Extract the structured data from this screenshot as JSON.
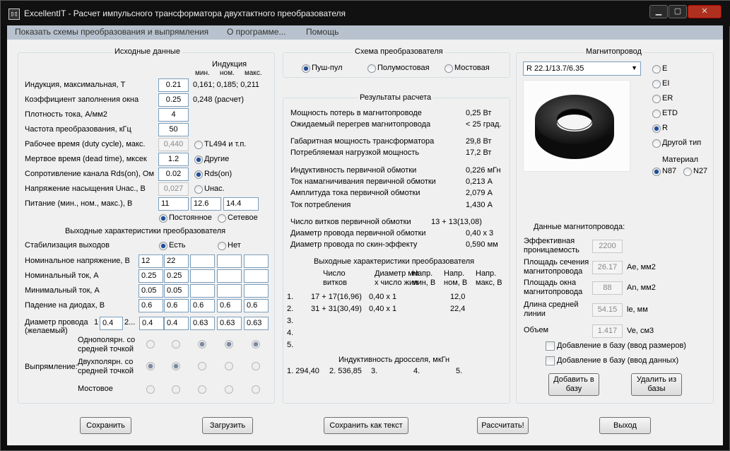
{
  "window": {
    "title": "ExcellentIT - Расчет импульсного трансформатора двухтактного преобразователя",
    "icon": "app-icon",
    "controls": [
      "minimize",
      "maximize",
      "close"
    ]
  },
  "menu": [
    "Показать схемы преобразования и выпрямления",
    "О программе...",
    "Помощь"
  ],
  "input": {
    "title": "Исходные данные",
    "induction_header": "Индукция",
    "induction_sub": [
      "мин.",
      "ном.",
      "макс."
    ],
    "rows": [
      {
        "label": "Индукция, максимальная, Т",
        "value": "0.21",
        "note": "0,161; 0,185; 0,211"
      },
      {
        "label": "Коэффициент заполнения окна",
        "value": "0.25",
        "note": "0,248 (расчет)"
      },
      {
        "label": "Плотность тока, А/мм2",
        "value": "4",
        "note": ""
      },
      {
        "label": "Частота преобразования, кГц",
        "value": "50",
        "note": ""
      },
      {
        "label": "Рабочее время (duty cycle), макс.",
        "value": "0,440",
        "note": "TL494 и т.п."
      },
      {
        "label": "Мертвое время (dead time), мксек",
        "value": "1.2",
        "note": "Другие"
      },
      {
        "label": "Сопротивление канала Rds(on), Ом",
        "value": "0.02",
        "note": "Rds(on)"
      },
      {
        "label": "Напряжение насыщения Uнас., В",
        "value": "0,027",
        "note": "Uнас."
      },
      {
        "label": "Питание (мин., ном., макс.), В",
        "values": [
          "11",
          "12.6",
          "14.4"
        ]
      }
    ],
    "supply": [
      "Постоянное",
      "Сетевое"
    ]
  },
  "output": {
    "title": "Выходные характеристики преобразователя",
    "stab_label": "Стабилизация выходов",
    "stab_options": [
      "Есть",
      "Нет"
    ],
    "rows": [
      {
        "label": "Номинальное напряжение, В",
        "cells": [
          "12",
          "22",
          "",
          "",
          ""
        ]
      },
      {
        "label": "Номинальный ток, А",
        "cells": [
          "0.25",
          "0.25",
          "",
          "",
          ""
        ]
      },
      {
        "label": "Минимальный ток, А",
        "cells": [
          "0.05",
          "0.05",
          "",
          "",
          ""
        ]
      },
      {
        "label": "Падение на диодах, В",
        "cells": [
          "0.6",
          "0.6",
          "0.6",
          "0.6",
          "0.6"
        ]
      },
      {
        "label": "Диаметр провода (желаемый)",
        "prefix": [
          "1",
          "2..."
        ],
        "primary": "0.4",
        "cells": [
          "0.4",
          "0.4",
          "0.63",
          "0.63",
          "0.63"
        ]
      }
    ],
    "rect_label": "Выпрямление:",
    "rect_modes": [
      "Однополярн. со средней точкой",
      "Двухполярн. со средней точкой",
      "Мостовое"
    ],
    "rect_matrix": [
      [
        false,
        false,
        true,
        true,
        true
      ],
      [
        true,
        true,
        false,
        false,
        false
      ],
      [
        false,
        false,
        false,
        false,
        false
      ]
    ]
  },
  "scheme": {
    "title": "Схема преобразователя",
    "options": [
      "Пуш-пул",
      "Полумостовая",
      "Мостовая"
    ],
    "selected": 0
  },
  "results": {
    "title": "Результаты расчета",
    "groups": [
      [
        [
          "Мощность потерь в магнитопроводе",
          "0,25 Вт"
        ],
        [
          "Ожидаемый перегрев магнитопровода",
          "< 25 град."
        ]
      ],
      [
        [
          "Габаритная мощность трансформатора",
          "29,8 Вт"
        ],
        [
          "Потребляемая нагрузкой мощность",
          "17,2 Вт"
        ]
      ],
      [
        [
          "Индуктивность первичной обмотки",
          "0,226 мГн"
        ],
        [
          "Ток намагничивания первичной обмотки",
          "0,213 А"
        ],
        [
          "Амплитуда тока первичной обмотки",
          "2,079 А"
        ],
        [
          "Ток потребления",
          "1,430 А"
        ]
      ],
      [
        [
          "Число витков первичной обмотки",
          "13 + 13(13,08)"
        ],
        [
          "Диаметр провода первичной обмотки",
          "0,40 x 3"
        ],
        [
          "Диаметр провода по скин-эффекту",
          "0,590 мм"
        ]
      ]
    ],
    "out_title": "Выходные характеристики преобразователя",
    "out_headers": [
      "Число витков",
      "Диаметр мм x число жил",
      "Напр. мин, В",
      "Напр. ном, В",
      "Напр. макс, В"
    ],
    "out_rows": [
      {
        "n": "1.",
        "turns": "17 + 17(16,96)",
        "wire": "0,40 x 1",
        "nom": "12,0"
      },
      {
        "n": "2.",
        "turns": "31 + 31(30,49)",
        "wire": "0,40 x 1",
        "nom": "22,4"
      },
      {
        "n": "3.",
        "turns": "",
        "wire": "",
        "nom": ""
      },
      {
        "n": "4.",
        "turns": "",
        "wire": "",
        "nom": ""
      },
      {
        "n": "5.",
        "turns": "",
        "wire": "",
        "nom": ""
      }
    ],
    "choke_title": "Индуктивность дросселя, мкГн",
    "choke": [
      "1. 294,40",
      "2. 536,85",
      "3.",
      "4.",
      "5."
    ]
  },
  "core": {
    "title": "Магнитопровод",
    "selected": "R 22.1/13.7/6.35",
    "types": [
      "E",
      "EI",
      "ER",
      "ETD",
      "R",
      "Другой тип"
    ],
    "type_selected": 4,
    "material_label": "Материал",
    "materials": [
      "N87",
      "N27"
    ],
    "material_selected": 0,
    "data_title": "Данные магнитопровода:",
    "params": [
      {
        "label": "Эффективная проницаемость",
        "value": "2200",
        "unit": ""
      },
      {
        "label": "Площадь сечения магнитопровода",
        "value": "26.17",
        "unit": "Ae, мм2"
      },
      {
        "label": "Площадь окна магнитопровода",
        "value": "88",
        "unit": "An, мм2"
      },
      {
        "label": "Длина средней линии",
        "value": "54.15",
        "unit": "le, мм"
      },
      {
        "label": "Объем",
        "value": "1.417",
        "unit": "Ve, см3"
      }
    ],
    "checks": [
      "Добавление в базу (ввод размеров)",
      "Добавление в базу (ввод данных)"
    ],
    "add_btn": "Добавить в базу",
    "del_btn": "Удалить из базы"
  },
  "buttons": [
    "Сохранить",
    "Загрузить",
    "Сохранить как текст",
    "Рассчитать!",
    "Выход"
  ]
}
